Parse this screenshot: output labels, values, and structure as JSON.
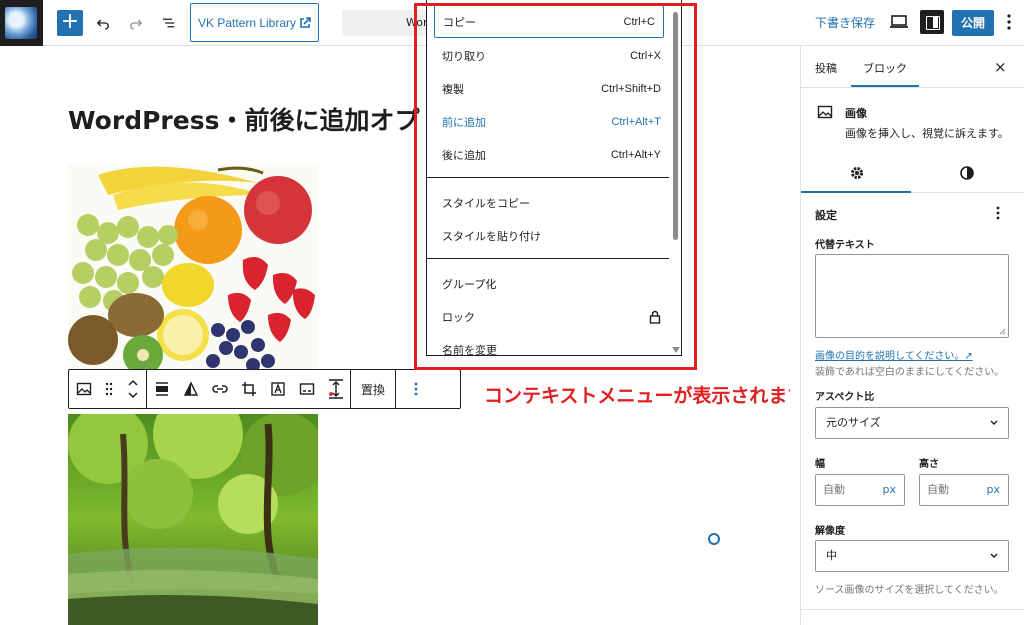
{
  "topbar": {
    "add_label": "+",
    "vk_button_label": "VK Pattern Library",
    "doc_bar_text": "Wor",
    "save_draft_label": "下書き保存",
    "publish_label": "公開"
  },
  "canvas": {
    "post_title": "WordPress・前後に追加オプ",
    "toolbar": {
      "replace_label": "置換"
    },
    "annotation": "コンテキストメニューが表示されます"
  },
  "context_menu": {
    "items": [
      {
        "label": "コピー",
        "shortcut": "Ctrl+C"
      },
      {
        "label": "切り取り",
        "shortcut": "Ctrl+X"
      },
      {
        "label": "複製",
        "shortcut": "Ctrl+Shift+D"
      },
      {
        "label": "前に追加",
        "shortcut": "Ctrl+Alt+T"
      },
      {
        "label": "後に追加",
        "shortcut": "Ctrl+Alt+Y"
      },
      {
        "label": "スタイルをコピー",
        "shortcut": ""
      },
      {
        "label": "スタイルを貼り付け",
        "shortcut": ""
      },
      {
        "label": "グループ化",
        "shortcut": ""
      },
      {
        "label": "ロック",
        "shortcut": ""
      },
      {
        "label": "名前を変更",
        "shortcut": ""
      }
    ]
  },
  "sidebar": {
    "tab_post": "投稿",
    "tab_block": "ブロック",
    "close": "×",
    "block_title": "画像",
    "block_description": "画像を挿入し、視覚に訴えます。",
    "settings_title": "設定",
    "alt_label": "代替テキスト",
    "alt_help_link": "画像の目的を説明してください。↗",
    "alt_help_text": "装飾であれば空白のままにしてください。",
    "aspect_label": "アスペクト比",
    "aspect_value": "元のサイズ",
    "width_label": "幅",
    "height_label": "高さ",
    "width_placeholder": "自動",
    "height_placeholder": "自動",
    "unit": "px",
    "resolution_label": "解像度",
    "resolution_value": "中",
    "resolution_help": "ソース画像のサイズを選択してください。"
  },
  "colors": {
    "accent": "#2271b1",
    "annotation": "#e02020",
    "dark": "#1e1e1e"
  }
}
